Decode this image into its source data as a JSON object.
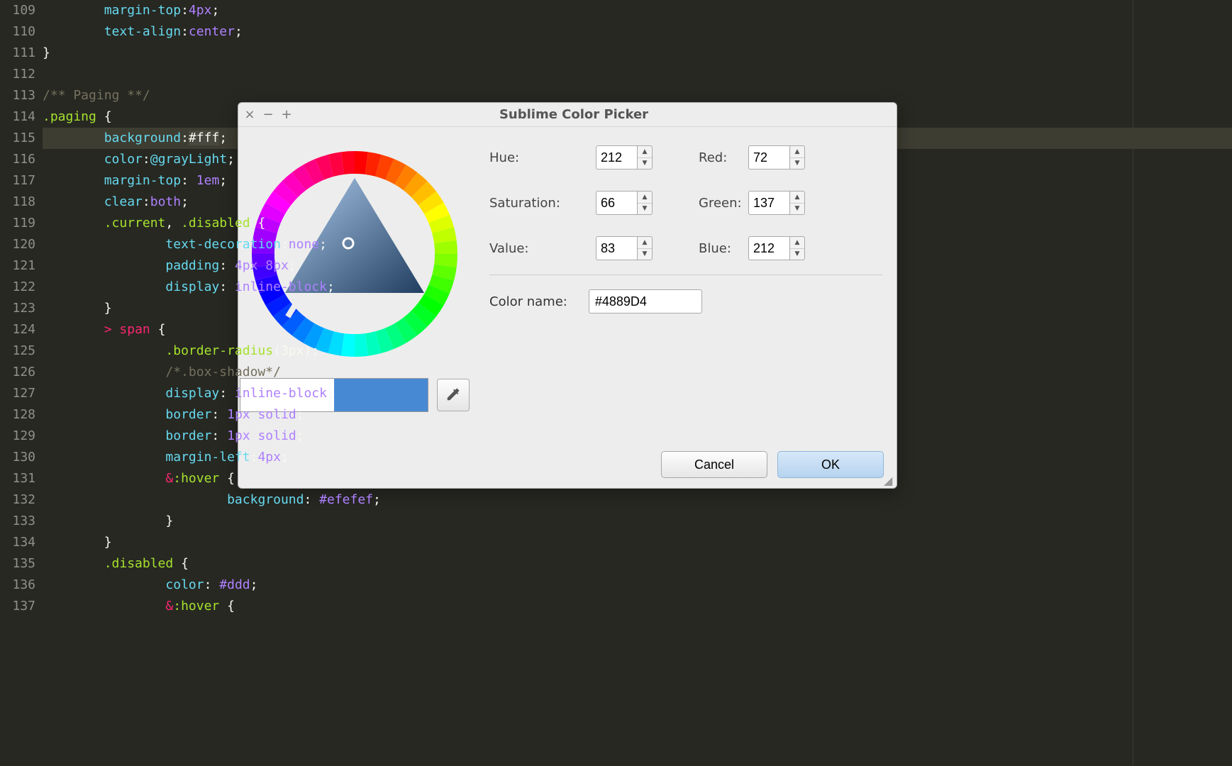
{
  "editor": {
    "first_line_number": 109,
    "highlighted_line_index": 6,
    "lines": [
      [
        [
          "",
          "        "
        ],
        [
          "prop",
          "margin-top"
        ],
        [
          "punct",
          ":"
        ],
        [
          "val",
          "4px"
        ],
        [
          "punct",
          ";"
        ]
      ],
      [
        [
          "",
          "        "
        ],
        [
          "prop",
          "text-align"
        ],
        [
          "punct",
          ":"
        ],
        [
          "val",
          "center"
        ],
        [
          "punct",
          ";"
        ]
      ],
      [
        [
          "punct",
          "}"
        ]
      ],
      [
        [
          "",
          ""
        ]
      ],
      [
        [
          "comment",
          "/** Paging **/"
        ]
      ],
      [
        [
          "sel",
          ".paging"
        ],
        [
          "",
          " "
        ],
        [
          "punct",
          "{"
        ]
      ],
      [
        [
          "",
          "        "
        ],
        [
          "prop",
          "background"
        ],
        [
          "punct",
          ":"
        ],
        [
          "hlsel",
          "#fff"
        ],
        [
          "punct",
          ";"
        ]
      ],
      [
        [
          "",
          "        "
        ],
        [
          "prop",
          "color"
        ],
        [
          "punct",
          ":"
        ],
        [
          "var",
          "@grayLight"
        ],
        [
          "punct",
          ";"
        ]
      ],
      [
        [
          "",
          "        "
        ],
        [
          "prop",
          "margin-top"
        ],
        [
          "punct",
          ": "
        ],
        [
          "val",
          "1em"
        ],
        [
          "punct",
          ";"
        ]
      ],
      [
        [
          "",
          "        "
        ],
        [
          "prop",
          "clear"
        ],
        [
          "punct",
          ":"
        ],
        [
          "val",
          "both"
        ],
        [
          "punct",
          ";"
        ]
      ],
      [
        [
          "",
          "        "
        ],
        [
          "sel",
          ".current"
        ],
        [
          "punct",
          ", "
        ],
        [
          "sel",
          ".disabled"
        ],
        [
          "",
          " "
        ],
        [
          "punct",
          "{"
        ]
      ],
      [
        [
          "",
          "                "
        ],
        [
          "prop",
          "text-decoration"
        ],
        [
          "punct",
          ":"
        ],
        [
          "val",
          "none"
        ],
        [
          "punct",
          ";"
        ]
      ],
      [
        [
          "",
          "                "
        ],
        [
          "prop",
          "padding"
        ],
        [
          "punct",
          ": "
        ],
        [
          "val",
          "4px 8px"
        ],
        [
          "punct",
          ";"
        ]
      ],
      [
        [
          "",
          "                "
        ],
        [
          "prop",
          "display"
        ],
        [
          "punct",
          ": "
        ],
        [
          "val",
          "inline-block"
        ],
        [
          "punct",
          ";"
        ]
      ],
      [
        [
          "",
          "        "
        ],
        [
          "punct",
          "}"
        ]
      ],
      [
        [
          "",
          "        "
        ],
        [
          "op",
          "> "
        ],
        [
          "tag",
          "span"
        ],
        [
          "",
          " "
        ],
        [
          "punct",
          "{"
        ]
      ],
      [
        [
          "",
          "                "
        ],
        [
          "sel",
          ".border-radius"
        ],
        [
          "punct",
          "(3px);"
        ]
      ],
      [
        [
          "",
          "                "
        ],
        [
          "comment",
          "/*.box-shadow*/"
        ]
      ],
      [
        [
          "",
          "                "
        ],
        [
          "prop",
          "display"
        ],
        [
          "punct",
          ": "
        ],
        [
          "val",
          "inline-block"
        ],
        [
          "punct",
          ";"
        ]
      ],
      [
        [
          "",
          "                "
        ],
        [
          "prop",
          "border"
        ],
        [
          "punct",
          ": "
        ],
        [
          "val",
          "1px"
        ],
        [
          "",
          " "
        ],
        [
          "val",
          "solid"
        ],
        [
          "punct",
          ";"
        ]
      ],
      [
        [
          "",
          "                "
        ],
        [
          "prop",
          "border"
        ],
        [
          "punct",
          ": "
        ],
        [
          "val",
          "1px"
        ],
        [
          "",
          " "
        ],
        [
          "val",
          "solid"
        ],
        [
          "punct",
          ";"
        ]
      ],
      [
        [
          "",
          "                "
        ],
        [
          "prop",
          "margin-left"
        ],
        [
          "punct",
          ":"
        ],
        [
          "val",
          "4px"
        ],
        [
          "punct",
          ";"
        ]
      ],
      [
        [
          "",
          "                "
        ],
        [
          "amp",
          "&"
        ],
        [
          "sel",
          ":hover"
        ],
        [
          "",
          " "
        ],
        [
          "punct",
          "{"
        ]
      ],
      [
        [
          "",
          "                        "
        ],
        [
          "prop",
          "background"
        ],
        [
          "punct",
          ": "
        ],
        [
          "val",
          "#efefef"
        ],
        [
          "punct",
          ";"
        ]
      ],
      [
        [
          "",
          "                "
        ],
        [
          "punct",
          "}"
        ]
      ],
      [
        [
          "",
          "        "
        ],
        [
          "punct",
          "}"
        ]
      ],
      [
        [
          "",
          "        "
        ],
        [
          "sel",
          ".disabled"
        ],
        [
          "",
          " "
        ],
        [
          "punct",
          "{"
        ]
      ],
      [
        [
          "",
          "                "
        ],
        [
          "prop",
          "color"
        ],
        [
          "punct",
          ": "
        ],
        [
          "val",
          "#ddd"
        ],
        [
          "punct",
          ";"
        ]
      ],
      [
        [
          "",
          "                "
        ],
        [
          "amp",
          "&"
        ],
        [
          "sel",
          ":hover"
        ],
        [
          "",
          " "
        ],
        [
          "punct",
          "{"
        ]
      ]
    ]
  },
  "dialog": {
    "title": "Sublime Color Picker",
    "hue_label": "Hue:",
    "hue_value": "212",
    "sat_label": "Saturation:",
    "sat_value": "66",
    "val_label": "Value:",
    "val_value": "83",
    "red_label": "Red:",
    "red_value": "72",
    "green_label": "Green:",
    "green_value": "137",
    "blue_label": "Blue:",
    "blue_value": "212",
    "color_name_label": "Color name:",
    "color_name_value": "#4889D4",
    "swatch_left": "#ffffff",
    "swatch_right": "#4889D4",
    "cancel_label": "Cancel",
    "ok_label": "OK"
  }
}
